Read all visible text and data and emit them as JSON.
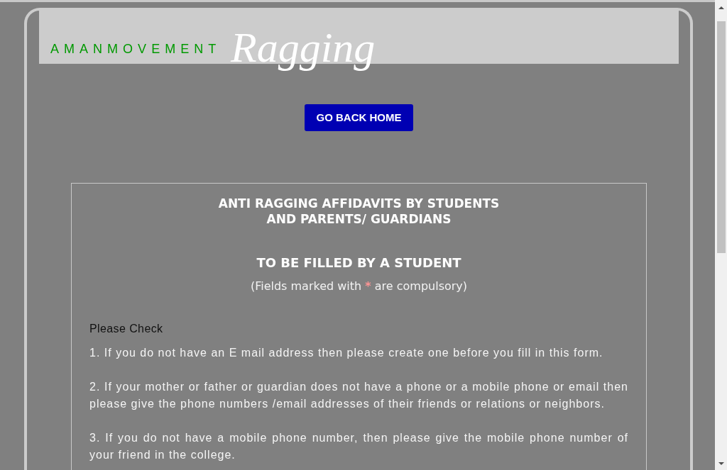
{
  "header": {
    "brand": "AMANMOVEMENT",
    "logo": "Ragging"
  },
  "home_button": {
    "label": "GO BACK HOME"
  },
  "form": {
    "title_lines": [
      "ANTI RAGGING AFFIDAVITS BY STUDENTS",
      "AND PARENTS/ GUARDIANS"
    ],
    "subtitle": "TO BE FILLED BY A STUDENT",
    "required_note": {
      "before": "(Fields marked with",
      "marker": "*",
      "after": "are compulsory)"
    },
    "instructions": {
      "heading": "Please Check",
      "items": [
        "1. If you do not have an E mail address then please create one before you fill in this form.",
        "2. If your mother or father or guardian does not have a phone or a mobile phone or email then please give the phone numbers /email addresses of their friends or relations or neighbors.",
        "3. If you do not have a mobile phone number, then please give the mobile phone number of your friend in the college."
      ]
    }
  }
}
